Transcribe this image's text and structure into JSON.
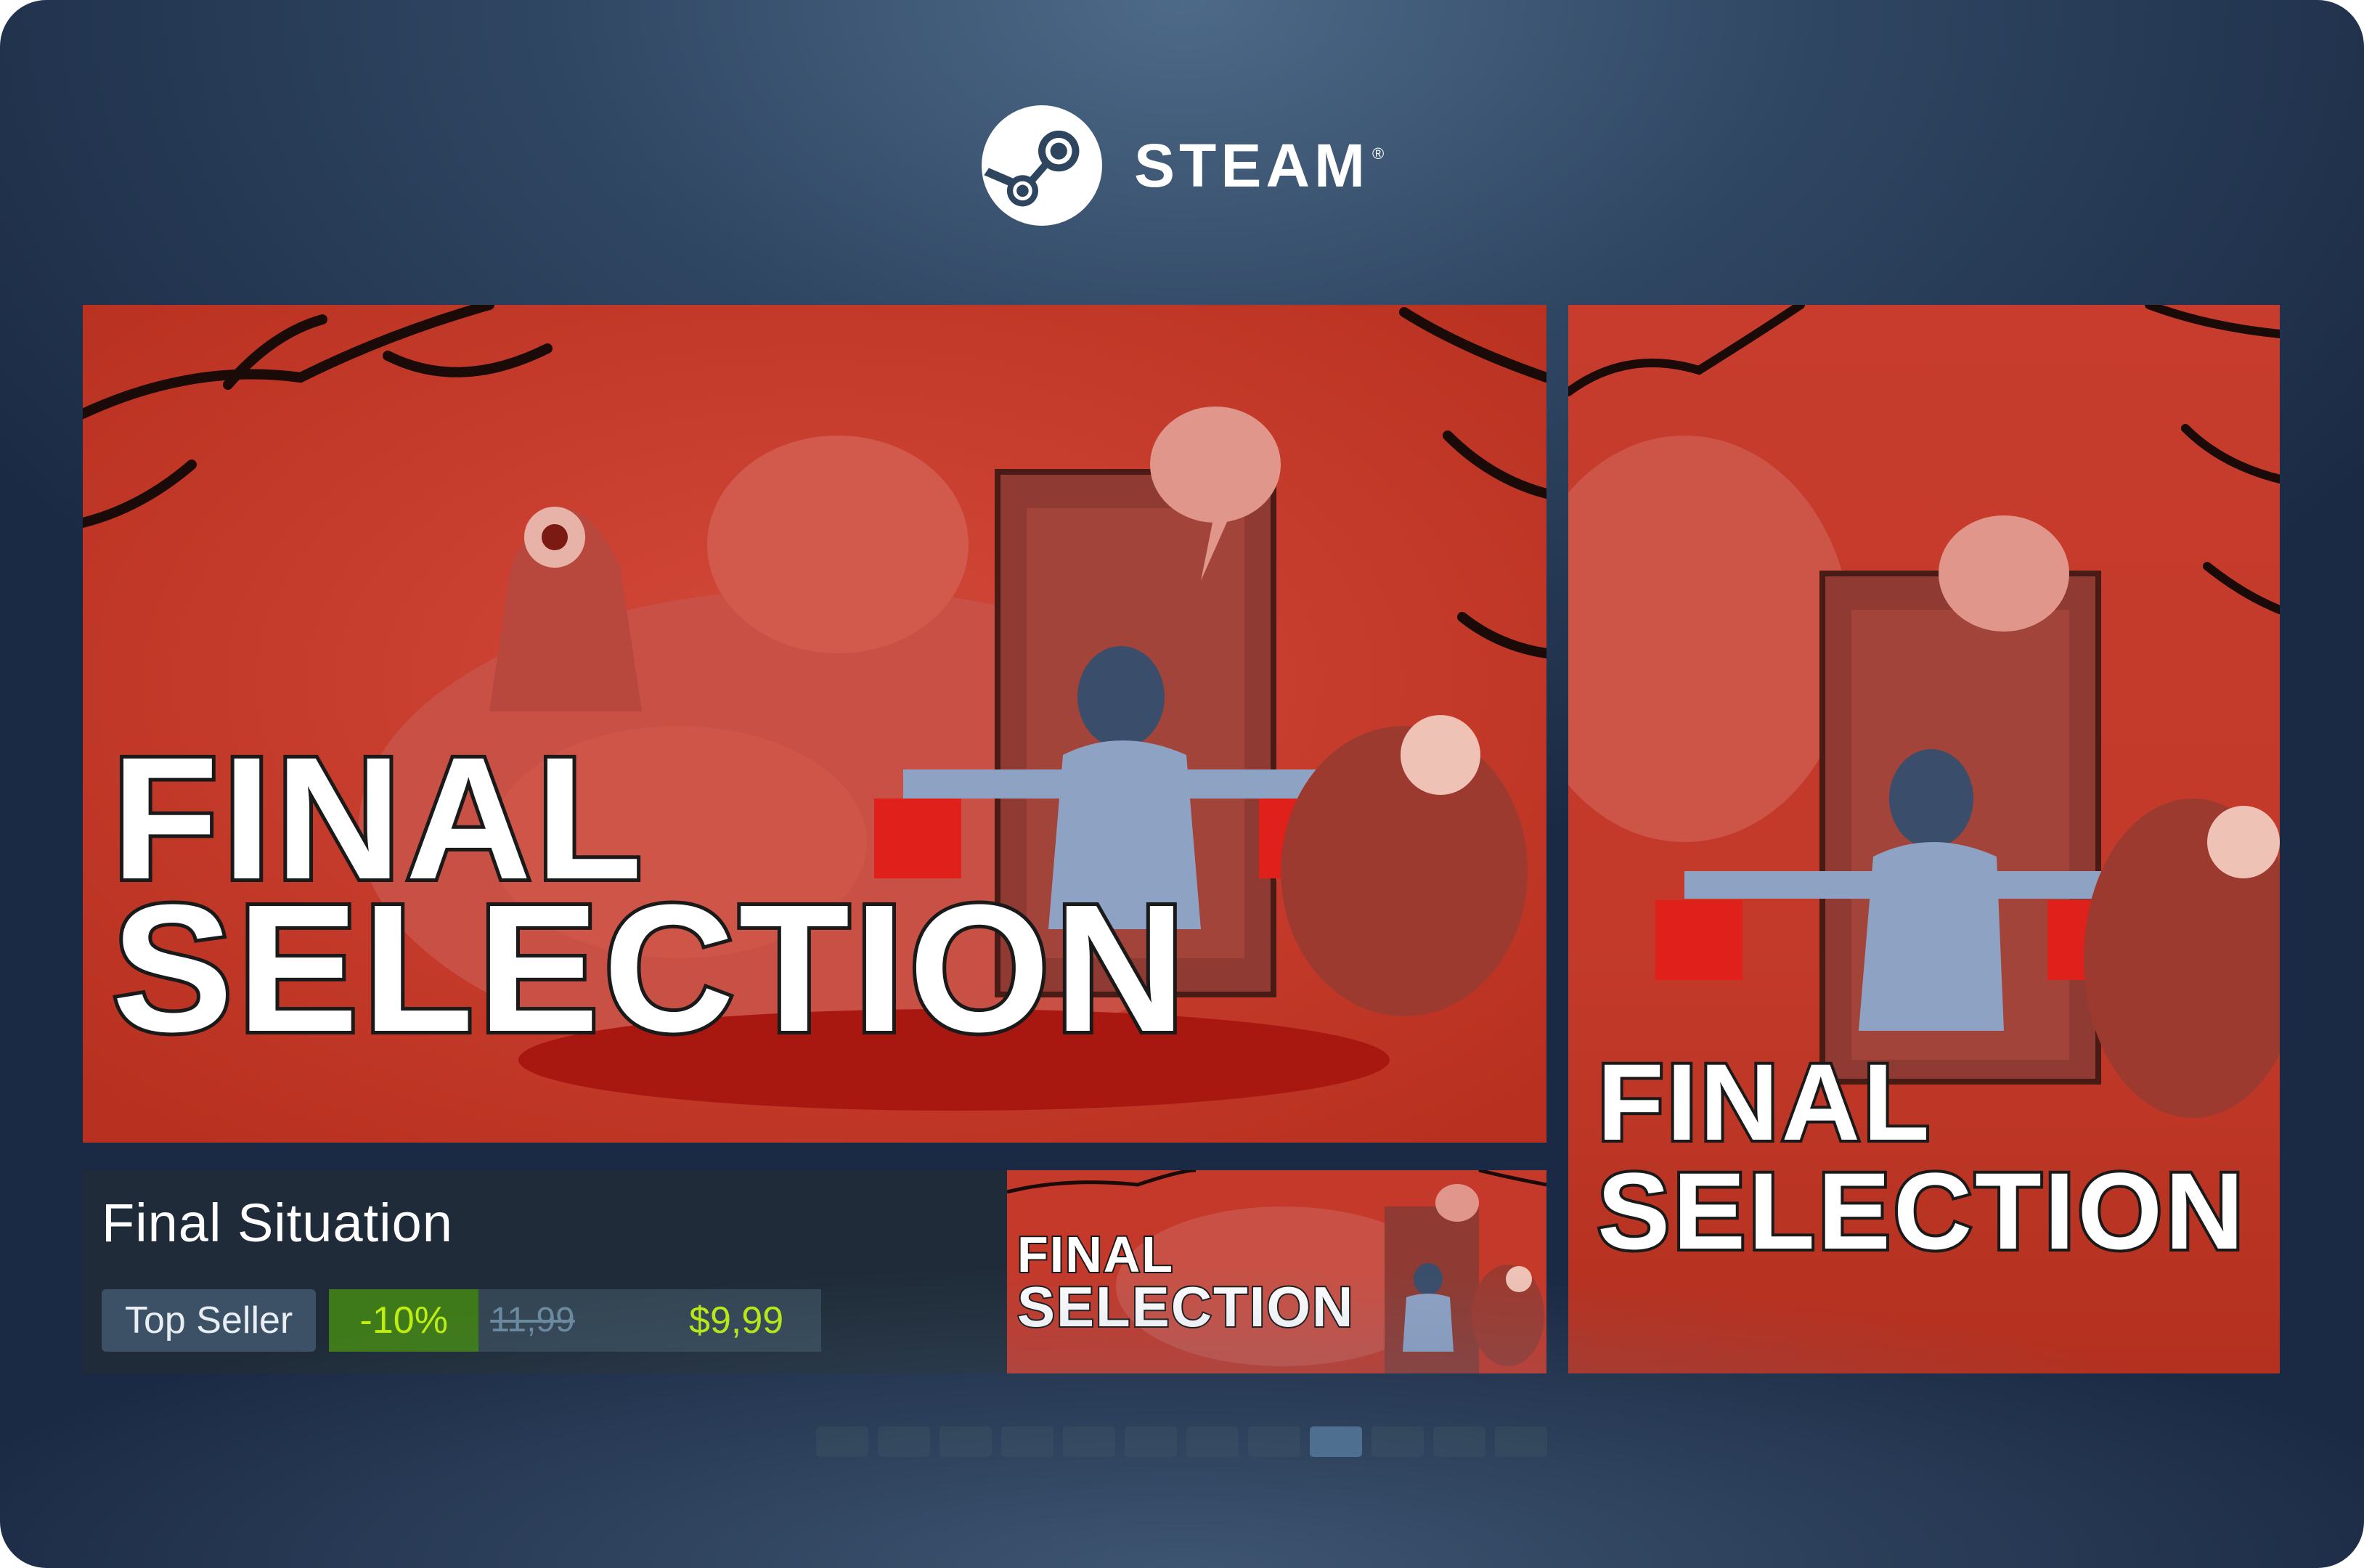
{
  "header": {
    "brand": "STEAM",
    "registered_mark": "®",
    "logo_icon": "steam-icon"
  },
  "hero_art": {
    "logo_line1": "FINAL",
    "logo_line2": "SELECTION"
  },
  "vertical_art": {
    "logo_line1": "FINAL",
    "logo_line2": "SELECTION"
  },
  "small_art": {
    "logo_line1": "FINAL",
    "logo_line2": "SELECTION"
  },
  "game": {
    "title": "Final Situation",
    "badge": "Top Seller",
    "discount": "-10%",
    "original_price": "11,99",
    "final_price": "$9,99"
  },
  "carousel": {
    "total_pages": 12,
    "active_index": 8
  },
  "colors": {
    "art_red": "#c23a2a",
    "price_green": "#beee11",
    "discount_bg": "#3f7a1a"
  }
}
